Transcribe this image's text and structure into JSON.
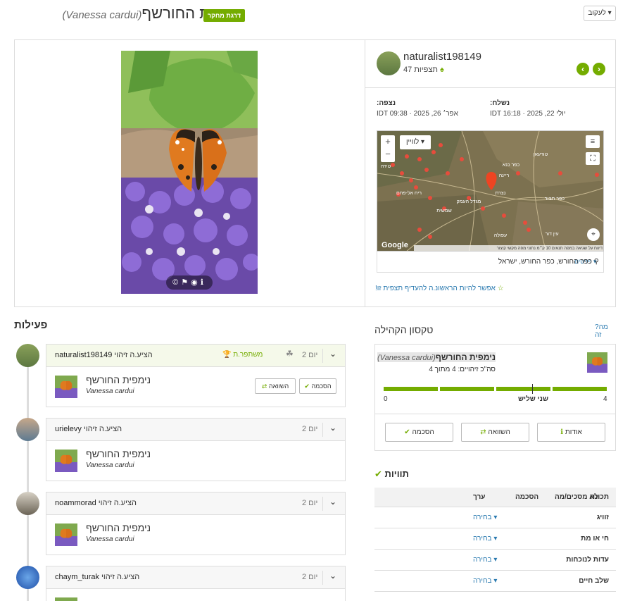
{
  "header": {
    "common_name": "נימפית החורשף",
    "sci_name": "(Vanessa cardui)",
    "grade_badge": "דרגת מחקר",
    "follow_button": "לעקוב ▾"
  },
  "observer": {
    "username": "naturalist198149",
    "observations_label": "תצפיות 47"
  },
  "dates": {
    "observed_label": ":נצפה",
    "observed_value": "IDT אפר׳ 26, 2025 · 09:38",
    "submitted_label": ":נשלח",
    "submitted_value": "IDT יולי 22, 2025 · 16:18"
  },
  "map": {
    "layer_button": "לוויין ▾",
    "zoom_in": "+",
    "zoom_out": "−",
    "google_logo": "Google",
    "attribution": "דיווח על שגיאה במפה  תנאים  10 ק״מ  נתוני מפה  מקשי קיצור",
    "place_labels": [
      "טורעאן",
      "כפר כנא",
      "ריינה",
      "נצרת",
      "כפר תבור",
      "מגדל העמק",
      "עפולה",
      "ריח אל-פחם",
      "עין דור",
      "שמשית",
      "טירה"
    ],
    "location_text": "כפר החורש, כפר החורש, ישראל",
    "details_link": "פרטים ▾"
  },
  "fave_text": "אפשר להיות הראשונ.ה להעדיף תצפית זו!",
  "activity": {
    "title": "פעילות",
    "items": [
      {
        "user": "naturalist198149",
        "verb": "הציע.ה זיהוי",
        "day": "יום 2",
        "tag": "משתפר.ת",
        "common": "נימפית החורשף",
        "sci": "Vanessa cardui",
        "agree": "הסכמה",
        "compare": "השוואה"
      },
      {
        "user": "urielevy",
        "verb": "הציע.ה זיהוי",
        "day": "יום 2",
        "common": "נימפית החורשף",
        "sci": "Vanessa cardui"
      },
      {
        "user": "noammorad",
        "verb": "הציע.ה זיהוי",
        "day": "יום 2",
        "common": "נימפית החורשף",
        "sci": "Vanessa cardui"
      },
      {
        "user": "chaym_turak",
        "verb": "הציע.ה זיהוי",
        "day": "יום 2"
      }
    ]
  },
  "community": {
    "title": "טקסון הקהילה",
    "what_is": "?מה זה",
    "common": "נימפית החורשף",
    "sci": "(Vanessa cardui)",
    "count_text": "סה\"כ זיהויים: 4 מתוך 4",
    "scale_left": "0",
    "scale_mid": "שני שליש",
    "scale_right": "4",
    "about": "אודות",
    "compare": "השוואה",
    "agree": "הסכמה",
    "agreement_fraction": 1.0
  },
  "annotations": {
    "title": "תוויות",
    "headers": [
      "תכונה",
      "ערך",
      "הסכמה",
      "לא מסכים/מה"
    ],
    "rows": [
      {
        "attr": "זוויג",
        "value": "בחירה ▾"
      },
      {
        "attr": "חי או מת",
        "value": "בחירה ▾"
      },
      {
        "attr": "עדות לנוכחות",
        "value": "בחירה ▾"
      },
      {
        "attr": "שלב חיים",
        "value": "בחירה ▾"
      }
    ]
  },
  "colors": {
    "accent": "#74ac00",
    "link": "#2a7ab0"
  }
}
